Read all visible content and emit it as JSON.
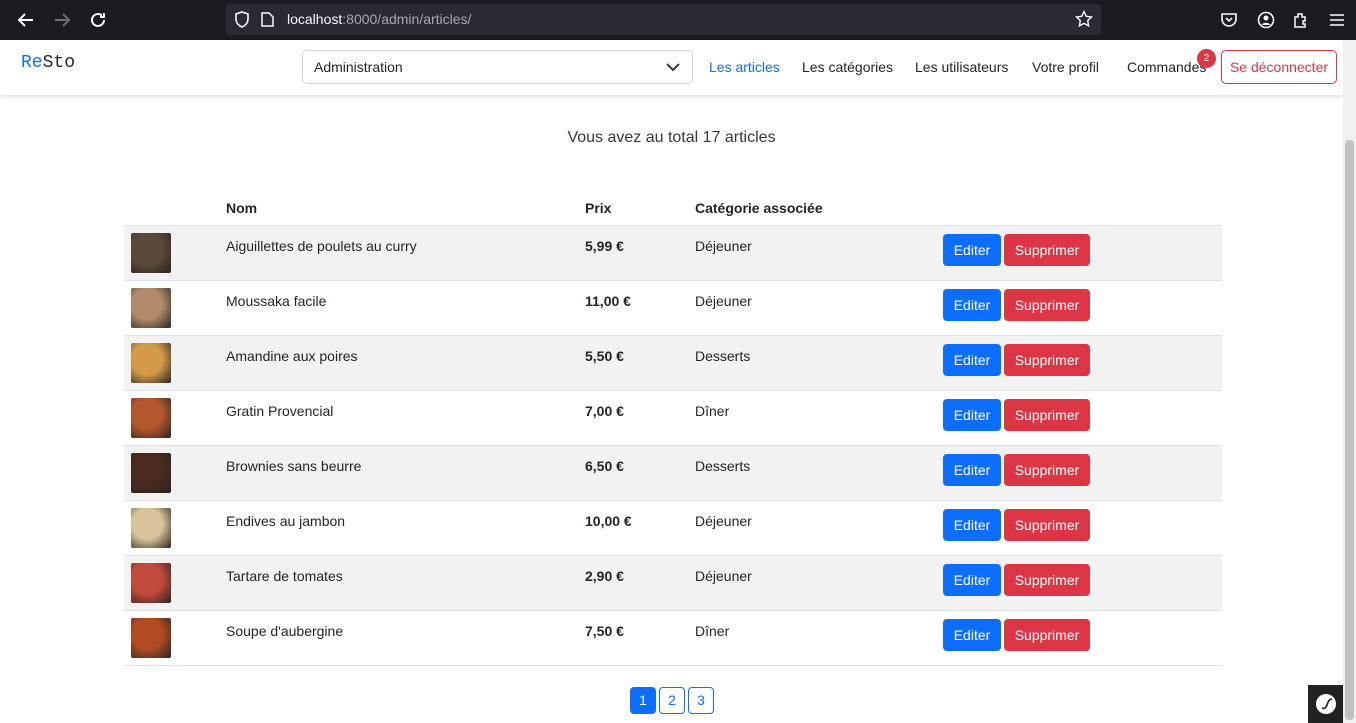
{
  "browser": {
    "url_host": "localhost",
    "url_rest": ":8000/admin/articles/"
  },
  "navbar": {
    "brand_accent": "Re",
    "brand_rest": "Sto",
    "select_value": "Administration",
    "links": [
      {
        "label": "Les articles"
      },
      {
        "label": "Les catégories"
      },
      {
        "label": "Les utilisateurs"
      },
      {
        "label": "Votre profil"
      },
      {
        "label": "Commandes"
      }
    ],
    "orders_badge": "2",
    "logout_label": "Se déconnecter"
  },
  "main": {
    "summary": "Vous avez au total 17 articles",
    "headers": {
      "name": "Nom",
      "price": "Prix",
      "category": "Catégorie associée"
    },
    "edit_label": "Editer",
    "delete_label": "Supprimer",
    "rows": [
      {
        "name": "Aiguillettes de poulets au curry",
        "price": "5,99 €",
        "category": "Déjeuner",
        "thumb": "#5a4a3a"
      },
      {
        "name": "Moussaka facile",
        "price": "11,00 €",
        "category": "Déjeuner",
        "thumb": "#b08a6a"
      },
      {
        "name": "Amandine aux poires",
        "price": "5,50 €",
        "category": "Desserts",
        "thumb": "#d49a4a"
      },
      {
        "name": "Gratin Provencial",
        "price": "7,00 €",
        "category": "Dîner",
        "thumb": "#b3572f"
      },
      {
        "name": "Brownies sans beurre",
        "price": "6,50 €",
        "category": "Desserts",
        "thumb": "#4a2a1e"
      },
      {
        "name": "Endives au jambon",
        "price": "10,00 €",
        "category": "Déjeuner",
        "thumb": "#d8c39a"
      },
      {
        "name": "Tartare de tomates",
        "price": "2,90 €",
        "category": "Déjeuner",
        "thumb": "#c24a3c"
      },
      {
        "name": "Soupe d'aubergine",
        "price": "7,50 €",
        "category": "Dîner",
        "thumb": "#b24a24"
      }
    ],
    "pages": [
      "1",
      "2",
      "3"
    ]
  }
}
